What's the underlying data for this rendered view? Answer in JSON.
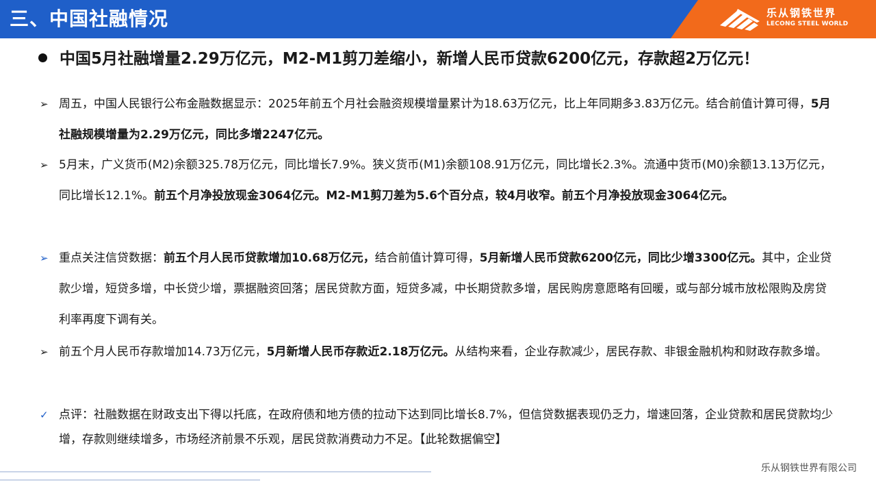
{
  "header": {
    "title": "三、中国社融情况",
    "logo_cn": "乐从钢铁世界",
    "logo_en": "LECONG STEEL WORLD",
    "bg_color": "#1f5fc9",
    "logo_bg_color": "#f26a1b"
  },
  "headline": "中国5月社融增量2.29万亿元，M2-M1剪刀差缩小，新增人民币贷款6200亿元，存款超2万亿元！",
  "paragraphs": [
    {
      "marker": "➢",
      "segments": [
        {
          "text": "周五，中国人民银行公布金融数据显示：2025年前五个月社会融资规模增量累计为18.63万亿元，比上年同期多3.83万亿元。结合前值计算可得，",
          "bold": false
        },
        {
          "text": "5月社融规模增量为2.29万亿元，同比多增2247亿元。",
          "bold": true
        }
      ]
    },
    {
      "marker": "➢",
      "segments": [
        {
          "text": "5月末，广义货币(M2)余额325.78万亿元，同比增长7.9%。狭义货币(M1)余额108.91万亿元，同比增长2.3%。流通中货币(M0)余额13.13万亿元，同比增长12.1%。",
          "bold": false
        },
        {
          "text": "前五个月净投放现金3064亿元。M2-M1剪刀差为5.6个百分点，较4月收窄。前五个月净投放现金3064亿元。",
          "bold": true
        }
      ]
    },
    {
      "marker": "➢",
      "segments": [
        {
          "text": "重点关注信贷数据：",
          "bold": false
        },
        {
          "text": "前五个月人民币贷款增加10.68万亿元，",
          "bold": true
        },
        {
          "text": "结合前值计算可得，",
          "bold": false
        },
        {
          "text": "5月新增人民币贷款6200亿元，同比少增3300亿元。",
          "bold": true
        },
        {
          "text": "其中，企业贷款少增，短贷多增，中长贷少增，票据融资回落；居民贷款方面，短贷多减，中长期贷款多增，居民购房意愿略有回暖，或与部分城市放松限购及房贷利率再度下调有关。",
          "bold": false
        }
      ]
    },
    {
      "marker": "➢",
      "segments": [
        {
          "text": "前五个月人民币存款增加14.73万亿元，",
          "bold": false
        },
        {
          "text": "5月新增人民币存款近2.18万亿元。",
          "bold": true
        },
        {
          "text": "从结构来看，企业存款减少，居民存款、非银金融机构和财政存款多增。",
          "bold": false
        }
      ]
    },
    {
      "marker": "✓",
      "segments": [
        {
          "text": "点评：社融数据在财政支出下得以托底，在政府债和地方债的拉动下达到同比增长8.7%，但信贷数据表现仍乏力，增速回落，企业贷款和居民贷款均少增，存款则继续增多，市场经济前景不乐观，居民贷款消费动力不足。【此轮数据偏空】",
          "bold": false
        }
      ]
    }
  ],
  "footer": {
    "company": "乐从钢铁世界有限公司"
  }
}
